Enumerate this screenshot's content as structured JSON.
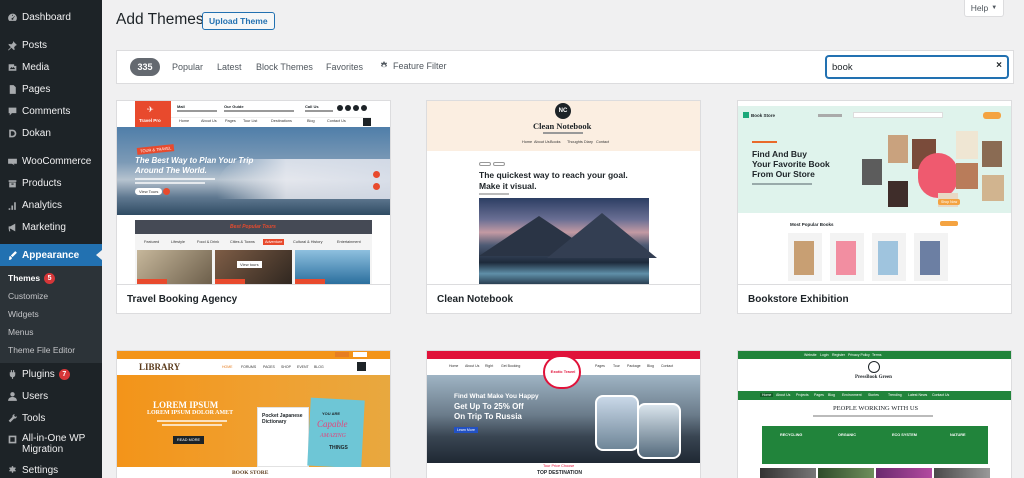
{
  "sidebar": {
    "items": [
      {
        "label": "Dashboard",
        "icon": "dashboard-icon"
      },
      {
        "label": "Posts",
        "icon": "pin-icon"
      },
      {
        "label": "Media",
        "icon": "media-icon"
      },
      {
        "label": "Pages",
        "icon": "pages-icon"
      },
      {
        "label": "Comments",
        "icon": "comment-icon"
      },
      {
        "label": "Dokan",
        "icon": "dokan-icon"
      },
      {
        "label": "WooCommerce",
        "icon": "woocommerce-icon"
      },
      {
        "label": "Products",
        "icon": "products-icon"
      },
      {
        "label": "Analytics",
        "icon": "analytics-icon"
      },
      {
        "label": "Marketing",
        "icon": "megaphone-icon"
      },
      {
        "label": "Appearance",
        "icon": "brush-icon"
      },
      {
        "label": "Plugins",
        "icon": "plug-icon",
        "badge": "7"
      },
      {
        "label": "Users",
        "icon": "users-icon"
      },
      {
        "label": "Tools",
        "icon": "wrench-icon"
      },
      {
        "label": "All-in-One WP Migration",
        "icon": "migration-icon"
      },
      {
        "label": "Settings",
        "icon": "settings-icon"
      }
    ],
    "appearance_sub": [
      {
        "label": "Themes",
        "badge": "5"
      },
      {
        "label": "Customize"
      },
      {
        "label": "Widgets"
      },
      {
        "label": "Menus"
      },
      {
        "label": "Theme File Editor"
      }
    ]
  },
  "header": {
    "title": "Add Themes",
    "upload_label": "Upload Theme",
    "help_label": "Help"
  },
  "filter_bar": {
    "count": "335",
    "tabs": [
      "Popular",
      "Latest",
      "Block Themes",
      "Favorites"
    ],
    "feature_filter_label": "Feature Filter",
    "search_value": "book",
    "clear_icon": "×"
  },
  "themes": [
    {
      "name": "Travel Booking Agency",
      "preview": {
        "logo": "Travel Pro",
        "contact": [
          "Mail",
          "Our Guide",
          "Call Us"
        ],
        "nav": [
          "Home",
          "About Us",
          "Pages",
          "Tour List",
          "Destinations",
          "Blog",
          "Contact Us"
        ],
        "hero_badge": "TOUR & TRAVEL",
        "hero_line1": "The Best Way to Plan Your Trip",
        "hero_line2": "Around The World.",
        "hero_button": "View Tours",
        "section_title": "Best Popular Tours",
        "section_tabs": [
          "Featured",
          "Lifestyle",
          "Food & Drink",
          "Cities & Towns",
          "Adventure",
          "Cultural & History",
          "Entertainment"
        ],
        "view_tours": "View tours"
      }
    },
    {
      "name": "Clean Notebook",
      "preview": {
        "logo_mark": "NC",
        "title": "Clean Notebook",
        "nav": [
          "Home",
          "About Us",
          "Books",
          "Thoughts",
          "Diary",
          "Contact"
        ],
        "headline1": "The quickest way to reach your goal.",
        "headline2": "Make it visual."
      }
    },
    {
      "name": "Bookstore Exhibition",
      "preview": {
        "logo": "Book Store",
        "hero_line1": "Find And Buy",
        "hero_line2": "Your Favorite Book",
        "hero_line3": "From Our Store",
        "hero_button": "Shop Now",
        "section_title": "Most Popular Books"
      }
    },
    {
      "name": "",
      "preview": {
        "logo": "LIBRARY",
        "nav": [
          "HOME",
          "FORUMS",
          "PAGES",
          "SHOP",
          "EVENT",
          "BLOG"
        ],
        "hero_line1": "LOREM IPSUM",
        "hero_line2": "LOREM IPSUM DOLOR AMET",
        "hero_button": "READ MORE",
        "book_title": "Pocket Japanese Dictionary",
        "book2_line1": "YOU ARE",
        "book2_line2": "Capable",
        "book2_line3": "AMAZING",
        "book2_line4": "THINGS",
        "footer": "BOOK STORE"
      }
    },
    {
      "name": "",
      "preview": {
        "logo": "Exotic Travel",
        "nav": [
          "Home",
          "About Us",
          "Right",
          "Get Booking",
          "Pages",
          "Tour",
          "Package",
          "Blog",
          "Contact"
        ],
        "hero_line1": "Find What Make You Happy",
        "hero_line2": "Get Up To 25% Off",
        "hero_line3": "On Trip To Russia",
        "hero_button": "Learn More",
        "section_small": "Tour Price Choose",
        "section_title": "TOP DESTINATION"
      }
    },
    {
      "name": "",
      "preview": {
        "topbar": [
          "Website",
          "Login",
          "Register",
          "Privacy Policy",
          "Terms"
        ],
        "logo": "PressBook Green",
        "nav": [
          "Home",
          "About Us",
          "Projects",
          "Pages",
          "Blog",
          "Environment",
          "Stories",
          "Trending",
          "Latest News",
          "Contact Us"
        ],
        "heading": "PEOPLE WORKING WITH US",
        "boxes": [
          "RECYCLING",
          "ORGANIC",
          "ECO SYSTEM",
          "NATURE"
        ]
      }
    }
  ],
  "colors": {
    "sidebar": "#1d2327",
    "accent": "#2271b1",
    "badge": "#d63638",
    "travel_red": "#e84a2d",
    "book_teal": "#d9f1ea",
    "library_orange": "#f39419",
    "green": "#21843b"
  }
}
